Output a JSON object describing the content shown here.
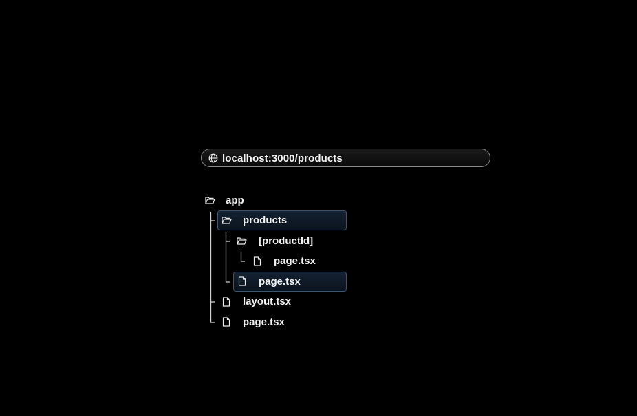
{
  "address_bar": {
    "url": "localhost:3000/products",
    "icon": "globe-icon"
  },
  "file_tree": {
    "root": {
      "name": "app",
      "icon": "folder-open-icon"
    },
    "products": {
      "name": "products",
      "icon": "folder-open-icon",
      "highlighted": true
    },
    "product_id": {
      "name": "[productId]",
      "icon": "folder-open-icon"
    },
    "product_id_page": {
      "name": "page.tsx",
      "icon": "file-icon"
    },
    "products_page": {
      "name": "page.tsx",
      "icon": "file-icon",
      "highlighted": true
    },
    "layout": {
      "name": "layout.tsx",
      "icon": "file-icon"
    },
    "root_page": {
      "name": "page.tsx",
      "icon": "file-icon"
    }
  },
  "colors": {
    "background": "#000000",
    "text": "#f2f2f2",
    "highlight_border": "#3a5570",
    "highlight_fill": "#142131",
    "connector": "#cfcfcf",
    "urlbar_border": "#8a8a8a"
  }
}
